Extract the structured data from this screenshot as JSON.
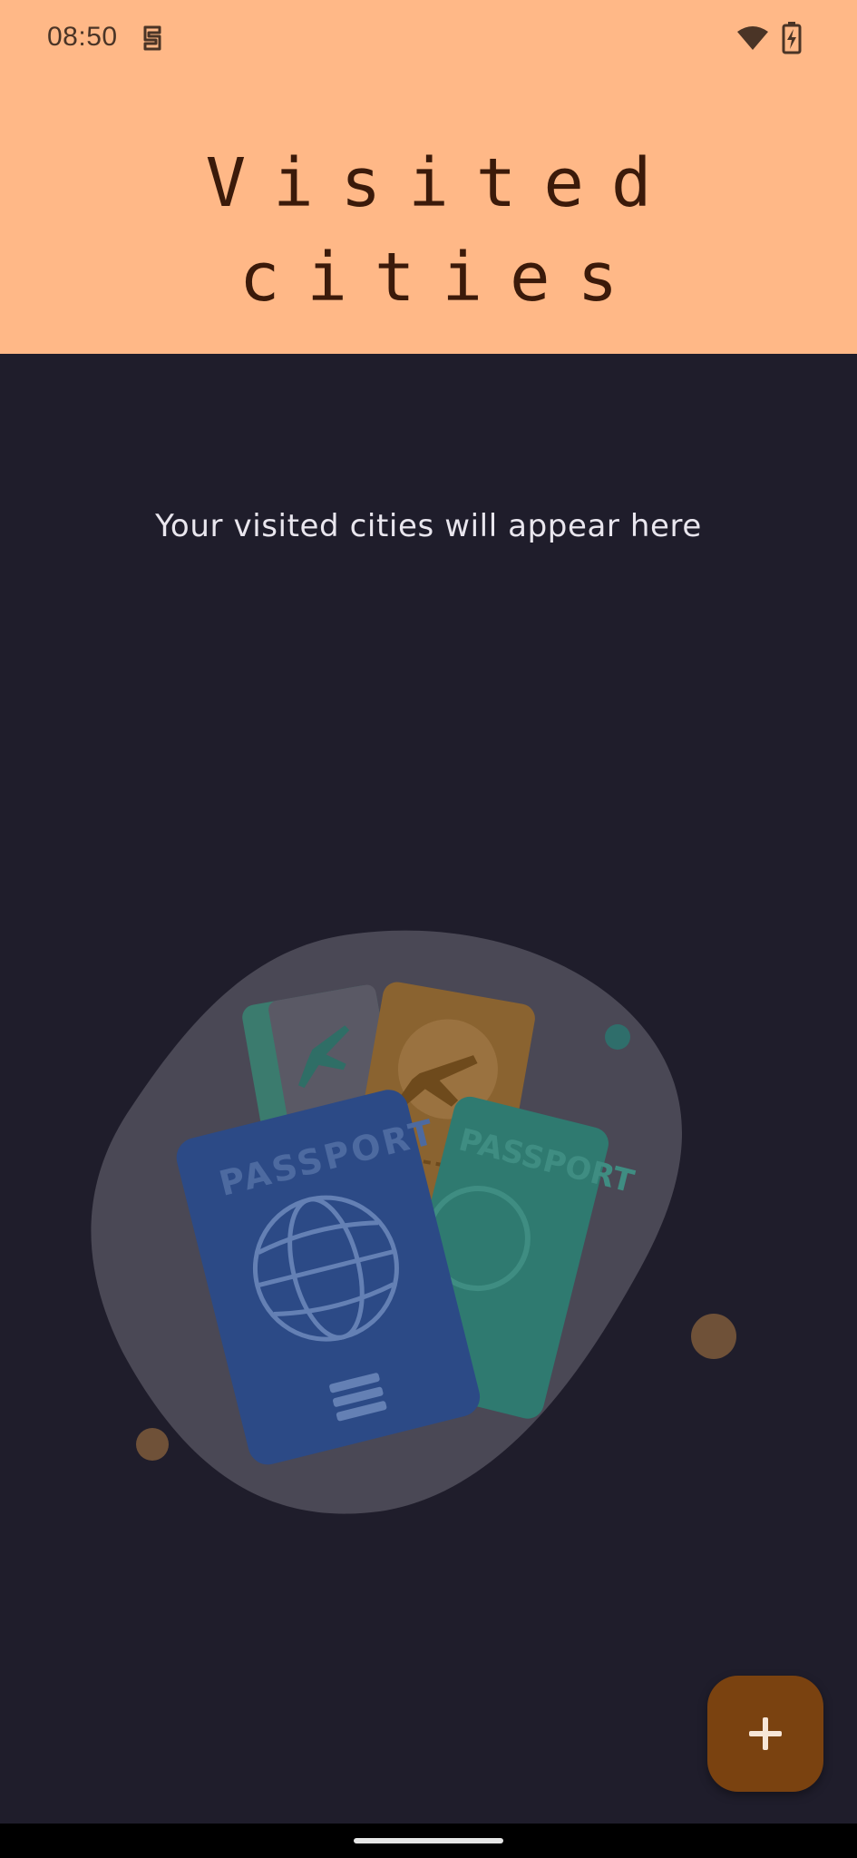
{
  "status_bar": {
    "time": "08:50",
    "icons": [
      "app-notification-icon",
      "wifi-icon",
      "battery-charging-icon"
    ]
  },
  "header": {
    "title": "Visited\ncities"
  },
  "empty_state": {
    "message": "Your visited cities will appear here",
    "illustration": {
      "passport_front_label": "PASSPORT",
      "passport_back_label": "PASSPORT"
    }
  },
  "fab": {
    "icon": "plus-icon"
  },
  "colors": {
    "header_bg": "#ffb887",
    "body_bg": "#1f1d2b",
    "title_text": "#3b1a0a",
    "fab_bg": "#7a4210"
  }
}
